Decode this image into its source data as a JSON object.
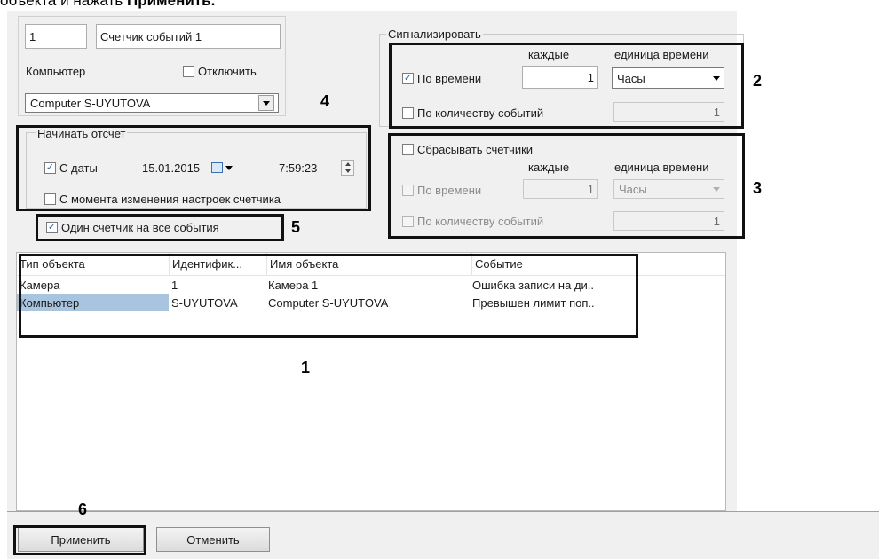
{
  "doc": {
    "prefix": "объекта и нажать ",
    "bold": "Применить."
  },
  "counter": {
    "id": "1",
    "name": "Счетчик событий 1"
  },
  "computer": {
    "label": "Компьютер",
    "disable_label": "Отключить",
    "disable_checked": false,
    "value": "Computer S-UYUTOVA"
  },
  "start": {
    "title": "Начинать отсчет",
    "from_date_label": "С даты",
    "from_date_checked": true,
    "date": "15.01.2015",
    "time": "7:59:23",
    "from_settings_label": "С момента изменения настроек счетчика",
    "from_settings_checked": false
  },
  "single_counter": {
    "label": "Один счетчик на все события",
    "checked": true
  },
  "alarm": {
    "title": "Сигнализировать",
    "each_label": "каждые",
    "unit_label": "единица времени",
    "by_time_label": "По времени",
    "by_time_checked": true,
    "each_value": "1",
    "unit_value": "Часы",
    "by_count_label": "По количеству событий",
    "by_count_checked": false,
    "count_value": "1"
  },
  "reset": {
    "label": "Сбрасывать счетчики",
    "checked": false,
    "each_label": "каждые",
    "unit_label": "единица времени",
    "by_time_label": "По времени",
    "each_value": "1",
    "unit_value": "Часы",
    "by_count_label": "По количеству событий",
    "count_value": "1"
  },
  "table": {
    "columns": [
      "Тип объекта",
      "Идентифик...",
      "Имя объекта",
      "Событие"
    ],
    "rows": [
      [
        "Камера",
        "1",
        "Камера 1",
        "Ошибка записи на ди.."
      ],
      [
        "Компьютер",
        "S-UYUTOVA",
        "Computer S-UYUTOVA",
        "Превышен лимит поп.."
      ]
    ]
  },
  "buttons": {
    "apply": "Применить",
    "cancel": "Отменить"
  },
  "markers": {
    "m1": "1",
    "m2": "2",
    "m3": "3",
    "m4": "4",
    "m5": "5",
    "m6": "6"
  },
  "glyphs": {
    "check": "✓"
  },
  "colors": {
    "selection": "#a9c4de",
    "accent": "#2a5ea8"
  }
}
